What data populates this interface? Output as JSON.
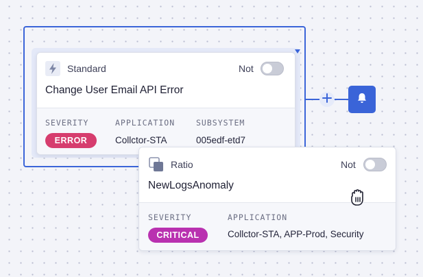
{
  "canvas": {
    "grid_dot_color": "#b9bdd0",
    "background_color": "#f3f4f9",
    "accent_color": "#3a64d8"
  },
  "connector": {
    "add_icon": "plus-icon",
    "notification_icon": "bell-icon"
  },
  "cards": [
    {
      "type_icon": "lightning-icon",
      "type_label": "Standard",
      "toggle_label": "Not",
      "toggle_on": false,
      "title": "Change User Email API Error",
      "fields": {
        "severity_header": "SEVERITY",
        "severity_value": "ERROR",
        "severity_color": "#d63d6e",
        "application_header": "APPLICATION",
        "application_value": "Collctor-STA",
        "subsystem_header": "SUBSYSTEM",
        "subsystem_value": "005edf-etd7"
      }
    },
    {
      "type_icon": "ratio-icon",
      "type_label": "Ratio",
      "toggle_label": "Not",
      "toggle_on": false,
      "title": "NewLogsAnomaly",
      "fields": {
        "severity_header": "SEVERITY",
        "severity_value": "CRITICAL",
        "severity_color": "#b931b0",
        "application_header": "APPLICATION",
        "application_value": "Collctor-STA, APP-Prod, Security"
      }
    }
  ],
  "cursor": {
    "icon": "hand-cursor-icon"
  }
}
